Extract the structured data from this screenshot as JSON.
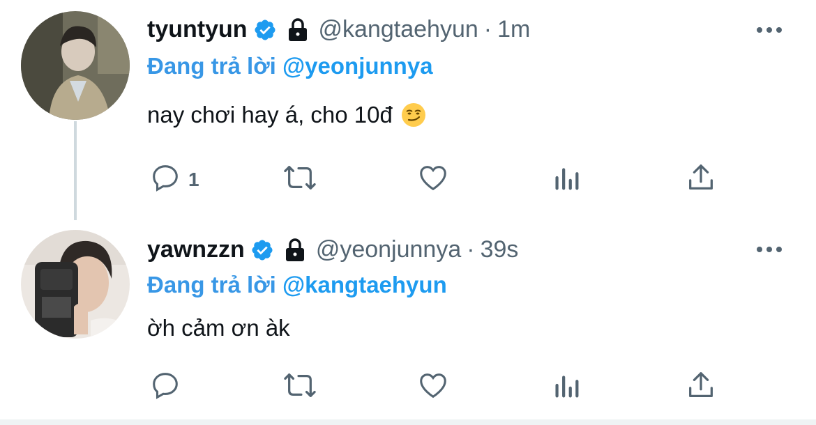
{
  "tweets": [
    {
      "display_name": "tyuntyun",
      "handle": "@kangtaehyun",
      "separator": "·",
      "time": "1m",
      "reply_prefix": "Đang trả lời",
      "reply_to": "@yeonjunnya",
      "text": "nay chơi hay á, cho 10đ",
      "emoji": "smirking-face",
      "reply_count": "1"
    },
    {
      "display_name": "yawnzzn",
      "handle": "@yeonjunnya",
      "separator": "·",
      "time": "39s",
      "reply_prefix": "Đang trả lời",
      "reply_to": "@kangtaehyun",
      "text": "ờh cảm ơn àk",
      "reply_count": ""
    }
  ],
  "colors": {
    "accent": "#1d9bf0",
    "muted": "#536471",
    "text": "#0f1419",
    "thread_line": "#cfd9de"
  },
  "icons": [
    "verified-badge-icon",
    "lock-icon",
    "more-icon",
    "reply-icon",
    "retweet-icon",
    "like-icon",
    "analytics-icon",
    "share-icon"
  ]
}
